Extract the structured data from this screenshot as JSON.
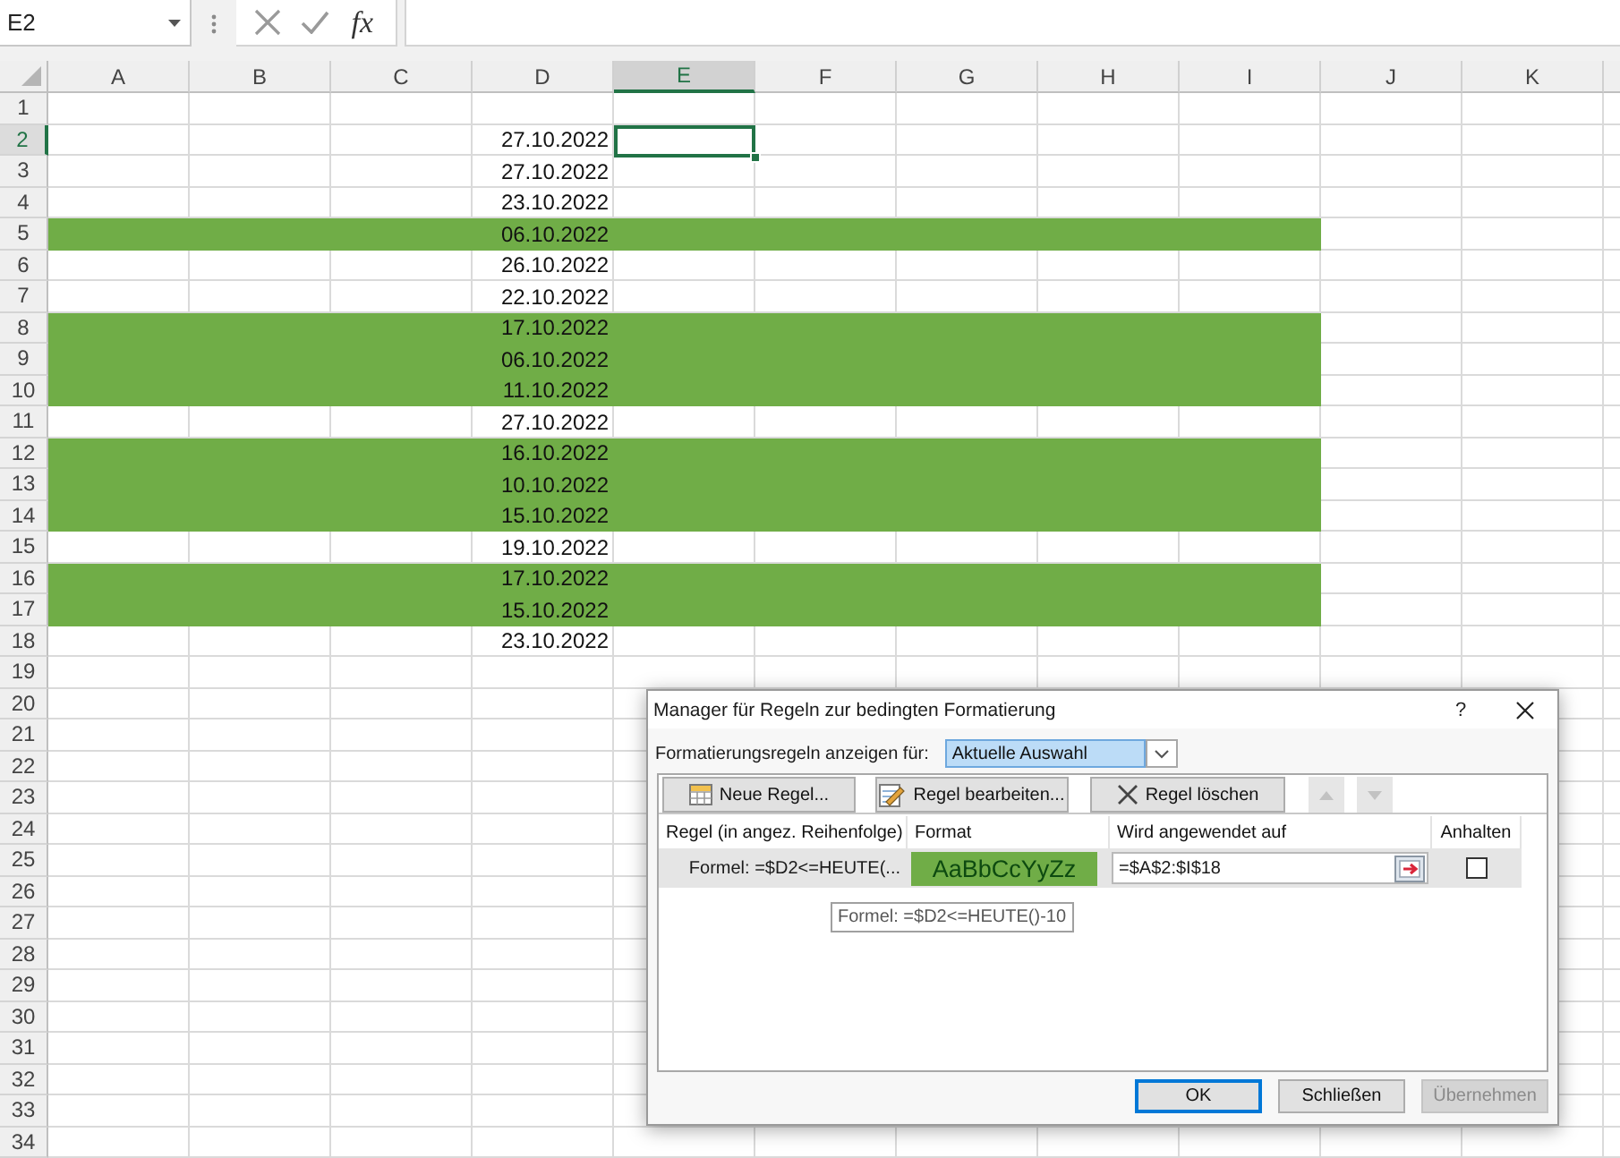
{
  "name_box": {
    "value": "E2"
  },
  "formula_bar": {
    "function_label": "fx"
  },
  "columns": [
    {
      "label": "A",
      "selected": false
    },
    {
      "label": "B",
      "selected": false
    },
    {
      "label": "C",
      "selected": false
    },
    {
      "label": "D",
      "selected": false
    },
    {
      "label": "E",
      "selected": true
    },
    {
      "label": "F",
      "selected": false
    },
    {
      "label": "G",
      "selected": false
    },
    {
      "label": "H",
      "selected": false
    },
    {
      "label": "I",
      "selected": false
    },
    {
      "label": "J",
      "selected": false
    },
    {
      "label": "K",
      "selected": false
    }
  ],
  "rows": [
    {
      "number": "1",
      "selected": false,
      "highlighted": false
    },
    {
      "number": "2",
      "selected": true,
      "highlighted": false,
      "d": "27.10.2022"
    },
    {
      "number": "3",
      "selected": false,
      "highlighted": false,
      "d": "27.10.2022"
    },
    {
      "number": "4",
      "selected": false,
      "highlighted": false,
      "d": "23.10.2022"
    },
    {
      "number": "5",
      "selected": false,
      "highlighted": true,
      "d": "06.10.2022"
    },
    {
      "number": "6",
      "selected": false,
      "highlighted": false,
      "d": "26.10.2022"
    },
    {
      "number": "7",
      "selected": false,
      "highlighted": false,
      "d": "22.10.2022"
    },
    {
      "number": "8",
      "selected": false,
      "highlighted": true,
      "d": "17.10.2022"
    },
    {
      "number": "9",
      "selected": false,
      "highlighted": true,
      "d": "06.10.2022"
    },
    {
      "number": "10",
      "selected": false,
      "highlighted": true,
      "d": "11.10.2022"
    },
    {
      "number": "11",
      "selected": false,
      "highlighted": false,
      "d": "27.10.2022"
    },
    {
      "number": "12",
      "selected": false,
      "highlighted": true,
      "d": "16.10.2022"
    },
    {
      "number": "13",
      "selected": false,
      "highlighted": true,
      "d": "10.10.2022"
    },
    {
      "number": "14",
      "selected": false,
      "highlighted": true,
      "d": "15.10.2022"
    },
    {
      "number": "15",
      "selected": false,
      "highlighted": false,
      "d": "19.10.2022"
    },
    {
      "number": "16",
      "selected": false,
      "highlighted": true,
      "d": "17.10.2022"
    },
    {
      "number": "17",
      "selected": false,
      "highlighted": true,
      "d": "15.10.2022"
    },
    {
      "number": "18",
      "selected": false,
      "highlighted": false,
      "d": "23.10.2022"
    },
    {
      "number": "19",
      "selected": false,
      "highlighted": false
    },
    {
      "number": "20",
      "selected": false,
      "highlighted": false
    },
    {
      "number": "21",
      "selected": false,
      "highlighted": false
    },
    {
      "number": "22",
      "selected": false,
      "highlighted": false
    },
    {
      "number": "23",
      "selected": false,
      "highlighted": false
    },
    {
      "number": "24",
      "selected": false,
      "highlighted": false
    },
    {
      "number": "25",
      "selected": false,
      "highlighted": false
    },
    {
      "number": "26",
      "selected": false,
      "highlighted": false
    },
    {
      "number": "27",
      "selected": false,
      "highlighted": false
    },
    {
      "number": "28",
      "selected": false,
      "highlighted": false
    },
    {
      "number": "29",
      "selected": false,
      "highlighted": false
    },
    {
      "number": "30",
      "selected": false,
      "highlighted": false
    },
    {
      "number": "31",
      "selected": false,
      "highlighted": false
    },
    {
      "number": "32",
      "selected": false,
      "highlighted": false
    },
    {
      "number": "33",
      "selected": false,
      "highlighted": false
    },
    {
      "number": "34",
      "selected": false,
      "highlighted": false
    }
  ],
  "dialog": {
    "title": "Manager für Regeln zur bedingten Formatierung",
    "help": "?",
    "scope": {
      "label": "Formatierungsregeln anzeigen für:",
      "value": "Aktuelle Auswahl"
    },
    "toolbar": [
      {
        "kind": "new",
        "label": "Neue Regel...",
        "disabled": false
      },
      {
        "kind": "edit",
        "label": "Regel bearbeiten...",
        "disabled": false
      },
      {
        "kind": "delete",
        "label": "Regel löschen",
        "disabled": false
      },
      {
        "kind": "move_up",
        "disabled": true
      },
      {
        "kind": "move_down",
        "disabled": true
      }
    ],
    "columns": [
      "Regel (in angez. Reihenfolge)",
      "Format",
      "Wird angewendet auf",
      "Anhalten"
    ],
    "rules": [
      {
        "description": "Formel: =$D2<=HEUTE(...",
        "preview": "AaBbCcYyZz",
        "applies_to": "=$A$2:$I$18",
        "stop_if_true": false,
        "selected": true
      }
    ],
    "tooltip": "Formel: =$D2<=HEUTE()-10",
    "buttons": [
      {
        "label": "OK",
        "default": true,
        "disabled": false
      },
      {
        "label": "Schließen",
        "default": false,
        "disabled": false
      },
      {
        "label": "Übernehmen",
        "default": false,
        "disabled": true
      }
    ]
  }
}
